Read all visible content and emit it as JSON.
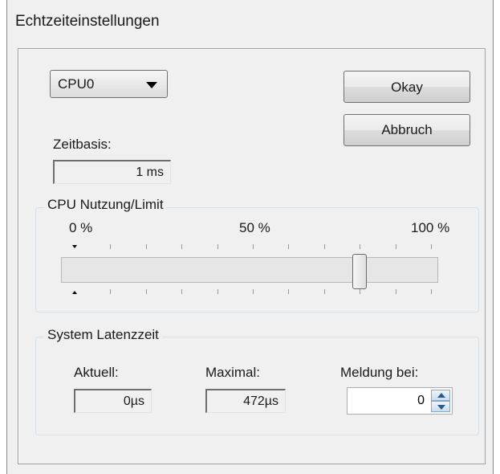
{
  "window": {
    "title": "Echtzeiteinstellungen"
  },
  "cpu_select": {
    "value": "CPU0"
  },
  "buttons": {
    "okay": "Okay",
    "abbruch": "Abbruch"
  },
  "zeitbasis": {
    "label": "Zeitbasis:",
    "value": "1 ms"
  },
  "cpu_usage": {
    "group_label": "CPU Nutzung/Limit",
    "scale_labels": [
      "0 %",
      "50 %",
      "100 %"
    ],
    "limit_percent": 80
  },
  "latency": {
    "group_label": "System Latenzzeit",
    "aktuell_label": "Aktuell:",
    "aktuell_value": "0µs",
    "maximal_label": "Maximal:",
    "maximal_value": "472µs",
    "meldung_label": "Meldung bei:",
    "meldung_value": "0"
  }
}
